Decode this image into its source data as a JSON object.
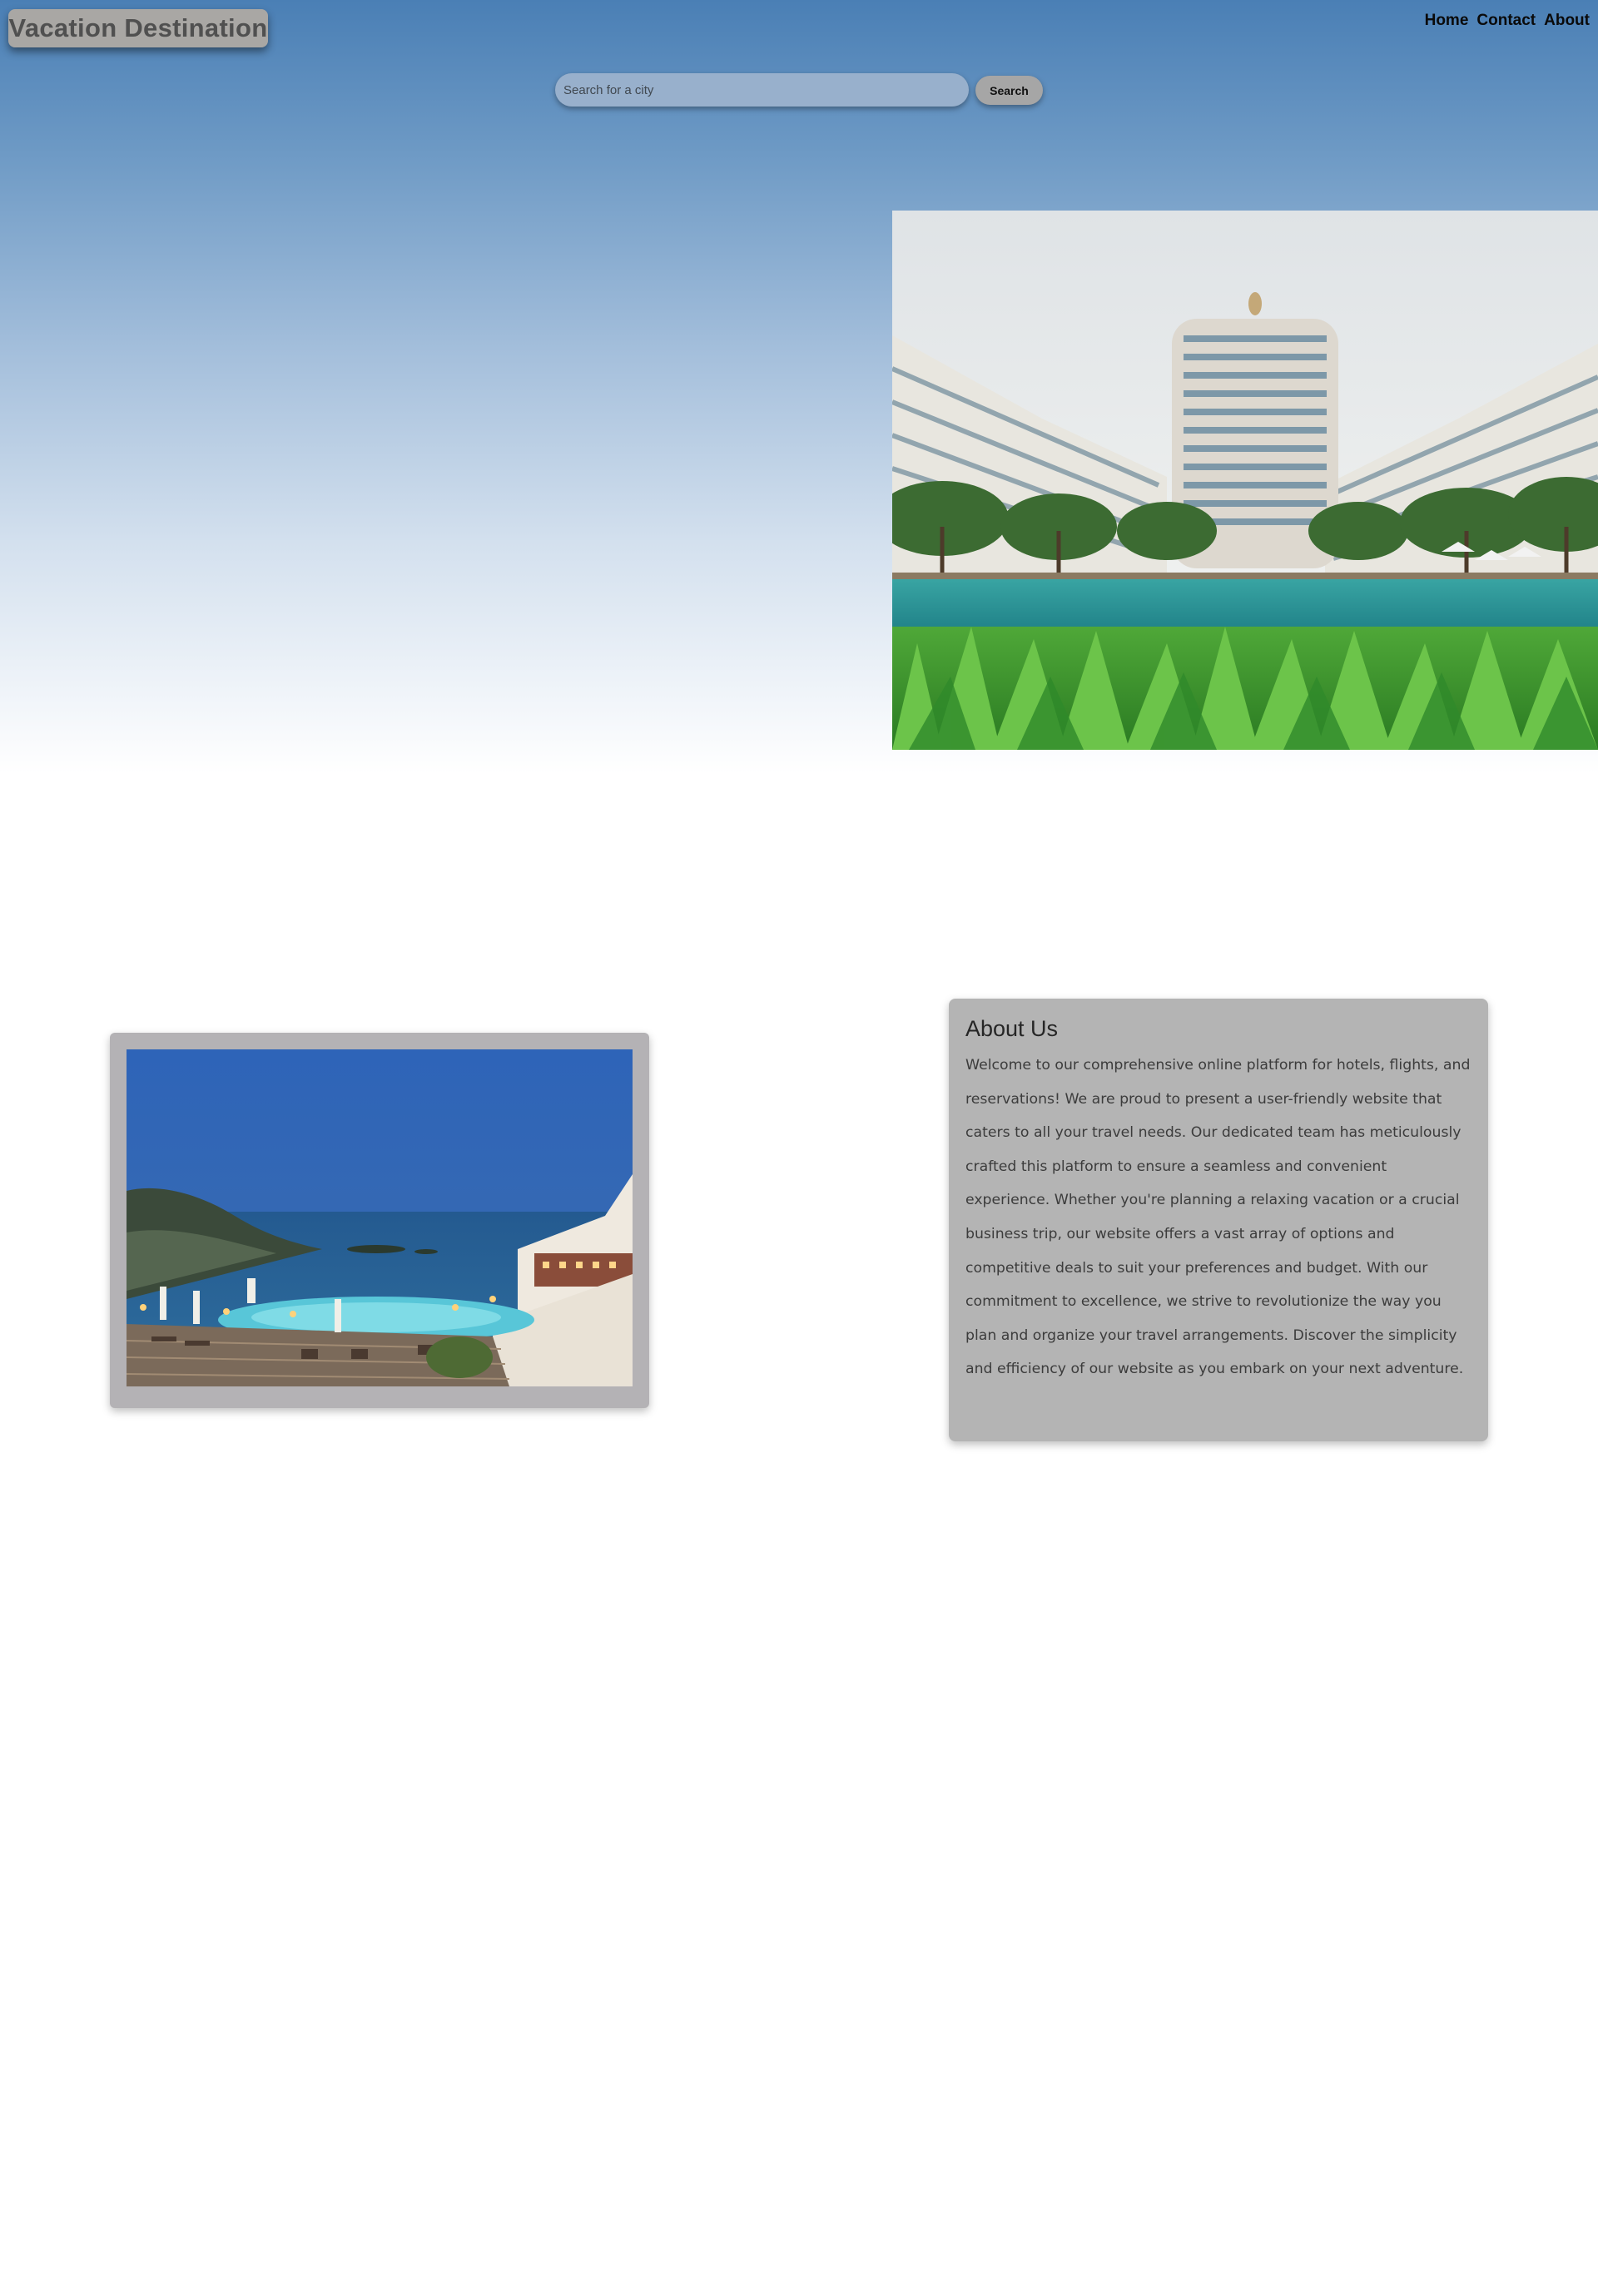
{
  "header": {
    "logo_text": "Vacation Destination",
    "nav": [
      {
        "label": "Home"
      },
      {
        "label": "Contact"
      },
      {
        "label": "About"
      }
    ]
  },
  "search": {
    "placeholder": "Search for a city",
    "value": "",
    "button_label": "Search"
  },
  "hero": {
    "image": "resort-hotel-tower-pool-palms-photo"
  },
  "feature_card": {
    "image": "seaside-resort-infinity-pool-dusk-photo"
  },
  "about": {
    "title": "About Us",
    "body": "Welcome to our comprehensive online platform for hotels, flights, and reservations! We are proud to present a user-friendly website that caters to all your travel needs. Our dedicated team has meticulously crafted this platform to ensure a seamless and convenient experience. Whether you're planning a relaxing vacation or a crucial business trip, our website offers a vast array of options and competitive deals to suit your preferences and budget. With our commitment to excellence, we strive to revolutionize the way you plan and organize your travel arrangements. Discover the simplicity and efficiency of our website as you embark on your next adventure."
  },
  "colors": {
    "header_gradient_top": "#4a7fb5",
    "button_gray": "#a6a6a6",
    "card_gray": "#b4b4b4"
  }
}
